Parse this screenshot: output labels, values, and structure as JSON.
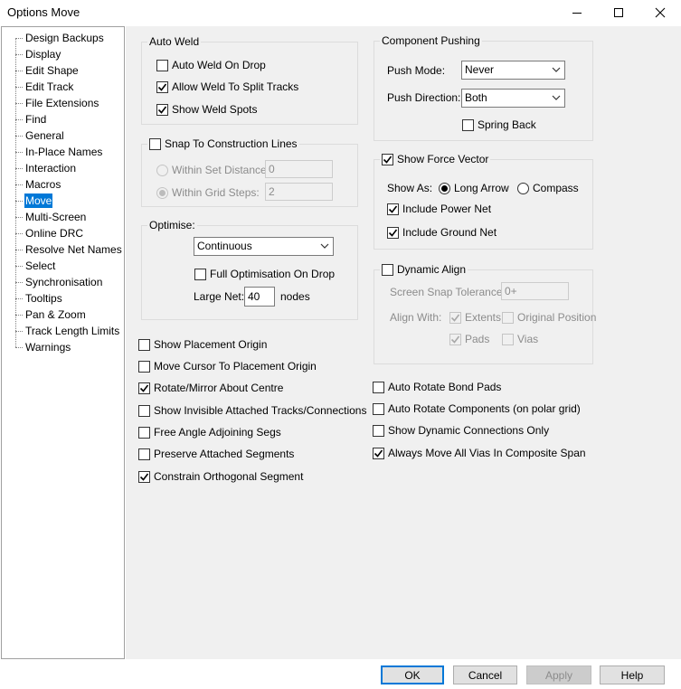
{
  "window": {
    "title": "Options  Move",
    "controls": {
      "minimize": "minimize-icon",
      "maximize": "maximize-icon",
      "close": "close-icon"
    }
  },
  "sidebar": {
    "selected": "Move",
    "items": [
      "Design Backups",
      "Display",
      "Edit Shape",
      "Edit Track",
      "File Extensions",
      "Find",
      "General",
      "In-Place Names",
      "Interaction",
      "Macros",
      "Move",
      "Multi-Screen",
      "Online DRC",
      "Resolve Net Names",
      "Select",
      "Synchronisation",
      "Tooltips",
      "Pan & Zoom",
      "Track Length Limits",
      "Warnings"
    ]
  },
  "auto_weld": {
    "title": "Auto Weld",
    "on_drop": {
      "label": "Auto Weld On Drop",
      "checked": false
    },
    "split_tracks": {
      "label": "Allow Weld To Split Tracks",
      "checked": true
    },
    "weld_spots": {
      "label": "Show Weld Spots",
      "checked": true
    }
  },
  "snap": {
    "title": "Snap To Construction Lines",
    "checked": false,
    "within_set_distance": {
      "label": "Within Set Distance:",
      "value": "0",
      "selected": false
    },
    "within_grid_steps": {
      "label": "Within Grid Steps:",
      "value": "2",
      "selected": true
    }
  },
  "optimise": {
    "title": "Optimise:",
    "mode": "Continuous",
    "full_on_drop": {
      "label": "Full Optimisation On Drop",
      "checked": false
    },
    "large_net_label": "Large Net:",
    "large_net_value": "40",
    "nodes_label": "nodes"
  },
  "component_pushing": {
    "title": "Component Pushing",
    "push_mode_label": "Push Mode:",
    "push_mode_value": "Never",
    "push_direction_label": "Push Direction:",
    "push_direction_value": "Both",
    "spring_back": {
      "label": "Spring Back",
      "checked": false
    }
  },
  "force_vector": {
    "title": "Show Force Vector",
    "checked": true,
    "show_as_label": "Show As:",
    "long_arrow": {
      "label": "Long Arrow",
      "selected": true
    },
    "compass": {
      "label": "Compass",
      "selected": false
    },
    "include_power": {
      "label": "Include Power Net",
      "checked": true
    },
    "include_ground": {
      "label": "Include Ground Net",
      "checked": true
    }
  },
  "dynamic_align": {
    "title": "Dynamic Align",
    "checked": false,
    "tolerance_label": "Screen Snap Tolerance:",
    "tolerance_value": "0+",
    "align_with_label": "Align With:",
    "extents": {
      "label": "Extents",
      "checked": true
    },
    "original_position": {
      "label": "Original Position",
      "checked": false
    },
    "pads": {
      "label": "Pads",
      "checked": true
    },
    "vias": {
      "label": "Vias",
      "checked": false
    }
  },
  "left_options": [
    {
      "label": "Show Placement Origin",
      "checked": false
    },
    {
      "label": "Move Cursor To Placement Origin",
      "checked": false
    },
    {
      "label": "Rotate/Mirror About Centre",
      "checked": true
    },
    {
      "label": "Show Invisible Attached Tracks/Connections",
      "checked": false
    },
    {
      "label": "Free Angle Adjoining Segs",
      "checked": false
    },
    {
      "label": "Preserve Attached Segments",
      "checked": false
    },
    {
      "label": "Constrain Orthogonal Segment",
      "checked": true
    }
  ],
  "right_options": [
    {
      "label": "Auto Rotate Bond Pads",
      "checked": false
    },
    {
      "label": "Auto Rotate Components (on polar grid)",
      "checked": false
    },
    {
      "label": "Show Dynamic Connections Only",
      "checked": false
    },
    {
      "label": "Always Move All Vias In Composite Span",
      "checked": true
    }
  ],
  "buttons": {
    "ok": "OK",
    "cancel": "Cancel",
    "apply": "Apply",
    "help": "Help"
  }
}
